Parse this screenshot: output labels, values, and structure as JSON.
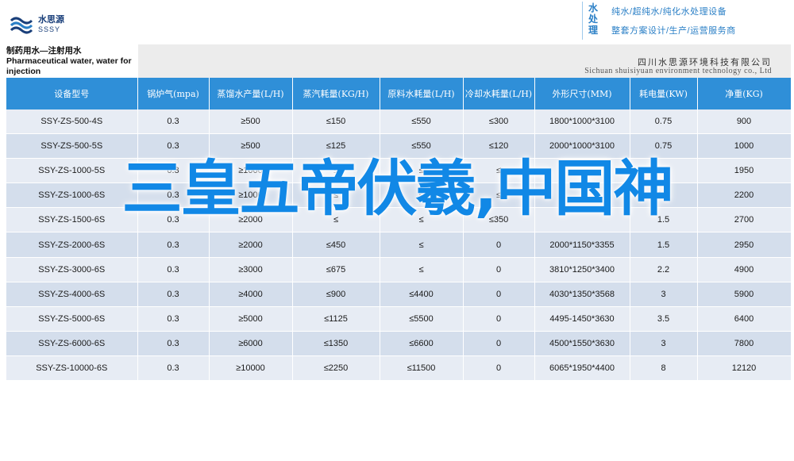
{
  "header": {
    "logo_cn": "水思源",
    "logo_en": "SSSY",
    "brand_vertical": "水处理",
    "brand_line_1": "纯水/超纯水/纯化水处理设备",
    "brand_line_2": "整套方案设计/生产/运营服务商"
  },
  "product_title": "制药用水—注射用水 Pharmaceutical water, water for injection",
  "company": {
    "cn": "四川水思源环境科技有限公司",
    "en": "Sichuan shuisiyuan environment technology co., Ltd"
  },
  "table": {
    "headers": [
      "设备型号",
      "锅炉气(mpa)",
      "蒸馏水产量(L/H)",
      "蒸汽耗量(KG/H)",
      "原料水耗量(L/H)",
      "冷却水耗量(L/H)",
      "外形尺寸(MM)",
      "耗电量(KW)",
      "净重(KG)"
    ],
    "rows": [
      [
        "SSY-ZS-500-4S",
        "0.3",
        "≥500",
        "≤150",
        "≤550",
        "≤300",
        "1800*1000*3100",
        "0.75",
        "900"
      ],
      [
        "SSY-ZS-500-5S",
        "0.3",
        "≥500",
        "≤125",
        "≤550",
        "≤120",
        "2000*1000*3100",
        "0.75",
        "1000"
      ],
      [
        "SSY-ZS-1000-5S",
        "0.3",
        "≥1000",
        "≤",
        "≤",
        "≤",
        "",
        "1.1",
        "1950"
      ],
      [
        "SSY-ZS-1000-6S",
        "0.3",
        "≥1000",
        "≤",
        "≤",
        "≤",
        "",
        "1.1",
        "2200"
      ],
      [
        "SSY-ZS-1500-6S",
        "0.3",
        "≥2000",
        "≤",
        "≤",
        "≤350",
        "",
        "1.5",
        "2700"
      ],
      [
        "SSY-ZS-2000-6S",
        "0.3",
        "≥2000",
        "≤450",
        "≤",
        "0",
        "2000*1150*3355",
        "1.5",
        "2950"
      ],
      [
        "SSY-ZS-3000-6S",
        "0.3",
        "≥3000",
        "≤675",
        "≤",
        "0",
        "3810*1250*3400",
        "2.2",
        "4900"
      ],
      [
        "SSY-ZS-4000-6S",
        "0.3",
        "≥4000",
        "≤900",
        "≤4400",
        "0",
        "4030*1350*3568",
        "3",
        "5900"
      ],
      [
        "SSY-ZS-5000-6S",
        "0.3",
        "≥5000",
        "≤1125",
        "≤5500",
        "0",
        "4495-1450*3630",
        "3.5",
        "6400"
      ],
      [
        "SSY-ZS-6000-6S",
        "0.3",
        "≥6000",
        "≤1350",
        "≤6600",
        "0",
        "4500*1550*3630",
        "3",
        "7800"
      ],
      [
        "SSY-ZS-10000-6S",
        "0.3",
        "≥10000",
        "≤2250",
        "≤11500",
        "0",
        "6065*1950*4400",
        "8",
        "12120"
      ]
    ]
  },
  "headline": "三皇五帝伏羲,中国神",
  "colors": {
    "header_blue": "#2f8fd8",
    "row_light": "#e7ecf4",
    "row_dark": "#d4deec",
    "headline_blue": "#1188e6",
    "brand_blue": "#2a7fc6"
  }
}
